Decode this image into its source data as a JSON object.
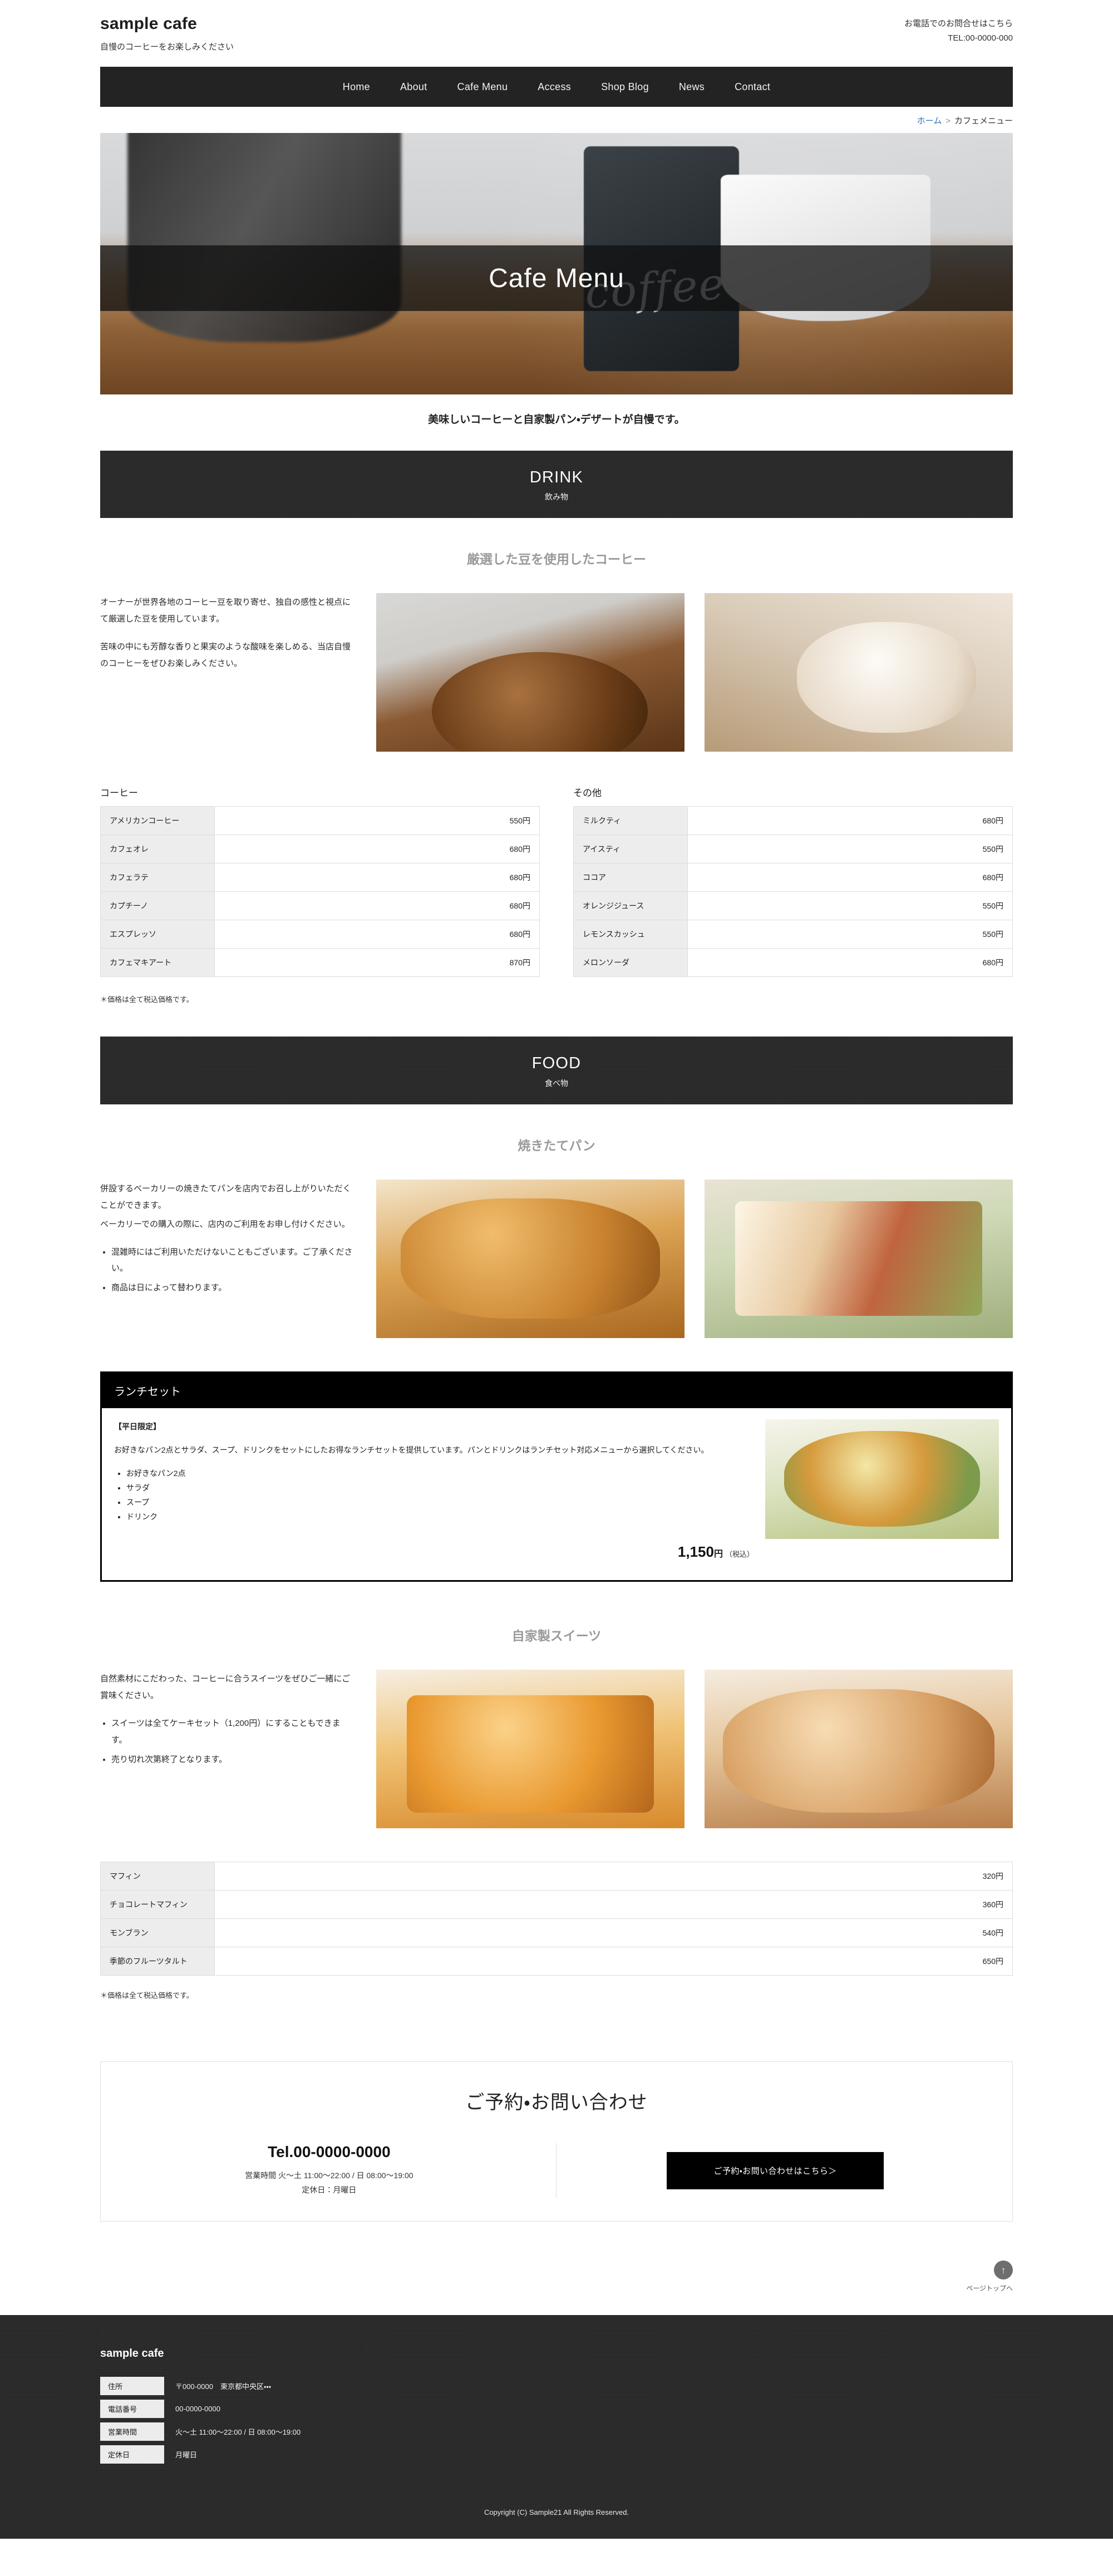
{
  "header": {
    "brand": "sample cafe",
    "tagline": "自慢のコーヒーをお楽しみください",
    "contact_label": "お電話でのお問合せはこちら",
    "contact_tel": "TEL:00-0000-000"
  },
  "nav": {
    "items": [
      {
        "label": "Home"
      },
      {
        "label": "About"
      },
      {
        "label": "Cafe Menu"
      },
      {
        "label": "Access"
      },
      {
        "label": "Shop Blog"
      },
      {
        "label": "News"
      },
      {
        "label": "Contact"
      }
    ]
  },
  "breadcrumb": {
    "home": "ホーム",
    "separator": ">",
    "current": "カフェメニュー"
  },
  "hero": {
    "title": "Cafe Menu",
    "script_overlay": "coffee",
    "lead": "美味しいコーヒーと自家製パン・デザートが自慢です。"
  },
  "drink": {
    "band_en": "DRINK",
    "band_ja": "飲み物",
    "subhead": "厳選した豆を使用したコーヒー",
    "paragraphs": [
      "オーナーが世界各地のコーヒー豆を取り寄せ、独自の感性と視点にて厳選した豆を使用しています。",
      "苦味の中にも芳醇な香りと果実のような酸味を楽しめる、当店自慢のコーヒーをぜひお楽しみください。"
    ],
    "images": [
      "coffee-beans-photo",
      "latte-photo"
    ],
    "tables": [
      {
        "title": "コーヒー",
        "rows": [
          {
            "name": "アメリカンコーヒー",
            "price": "550円"
          },
          {
            "name": "カフェオレ",
            "price": "680円"
          },
          {
            "name": "カフェラテ",
            "price": "680円"
          },
          {
            "name": "カプチーノ",
            "price": "680円"
          },
          {
            "name": "エスプレッソ",
            "price": "680円"
          },
          {
            "name": "カフェマキアート",
            "price": "870円"
          }
        ]
      },
      {
        "title": "その他",
        "rows": [
          {
            "name": "ミルクティ",
            "price": "680円"
          },
          {
            "name": "アイスティ",
            "price": "550円"
          },
          {
            "name": "ココア",
            "price": "680円"
          },
          {
            "name": "オレンジジュース",
            "price": "550円"
          },
          {
            "name": "レモンスカッシュ",
            "price": "550円"
          },
          {
            "name": "メロンソーダ",
            "price": "680円"
          }
        ]
      }
    ],
    "note": "＊価格は全て税込価格です。"
  },
  "food": {
    "band_en": "FOOD",
    "band_ja": "食べ物",
    "subhead": "焼きたてパン",
    "paragraphs": [
      "併設するベーカリーの焼きたてパンを店内でお召し上がりいただくことができます。",
      "ベーカリーでの購入の際に、店内のご利用をお申し付けください。"
    ],
    "bullets": [
      "混雑時にはご利用いただけないこともございます。ご了承ください。",
      "商品は日によって替わります。"
    ],
    "images": [
      "croissant-photo",
      "sandwich-photo"
    ],
    "lunch": {
      "title": "ランチセット",
      "tag": "【平日限定】",
      "description": "お好きなパン2点とサラダ、スープ、ドリンクをセットにしたお得なランチセットを提供しています。パンとドリンクはランチセット対応メニューから選択してください。",
      "items": [
        "お好きなパン2点",
        "サラダ",
        "スープ",
        "ドリンク"
      ],
      "price_number": "1,150",
      "price_yen": "円",
      "price_tax": "（税込）",
      "image": "lunch-salad-photo"
    }
  },
  "sweets": {
    "subhead": "自家製スイーツ",
    "paragraphs": [
      "自然素材にこだわった、コーヒーに合うスイーツをぜひご一緒にご賞味ください。"
    ],
    "bullets": [
      "スイーツは全てケーキセット（1,200円）にすることもできます。",
      "売り切れ次第終了となります。"
    ],
    "images": [
      "fruit-cake-photo",
      "pastry-photo"
    ],
    "rows": [
      {
        "name": "マフィン",
        "price": "320円"
      },
      {
        "name": "チョコレートマフィン",
        "price": "360円"
      },
      {
        "name": "モンブラン",
        "price": "540円"
      },
      {
        "name": "季節のフルーツタルト",
        "price": "650円"
      }
    ],
    "note": "＊価格は全て税込価格です。"
  },
  "contact": {
    "title": "ご予約・お問い合わせ",
    "tel": "Tel.00-0000-0000",
    "hours": "営業時間 火～土 11:00～22:00 / 日 08:00～19:00",
    "closed": "定休日：月曜日",
    "button": "ご予約・お問い合わせはこちら＞"
  },
  "pagetop": {
    "arrow": "↑",
    "label": "ページトップへ"
  },
  "footer": {
    "brand": "sample cafe",
    "rows": [
      {
        "label": "住所",
        "value": "〒000-0000　東京都中央区・・・"
      },
      {
        "label": "電話番号",
        "value": "00-0000-0000"
      },
      {
        "label": "営業時間",
        "value": "火～土 11:00～22:00 / 日 08:00～19:00"
      },
      {
        "label": "定休日",
        "value": "月曜日"
      }
    ],
    "copyright": "Copyright (C) Sample21 All Rights Reserved."
  },
  "colors": {
    "band_dark": "#262626",
    "nav_dark": "#232323",
    "link_blue": "#2a6ebb",
    "subhead_gray": "#9a9a9a"
  }
}
